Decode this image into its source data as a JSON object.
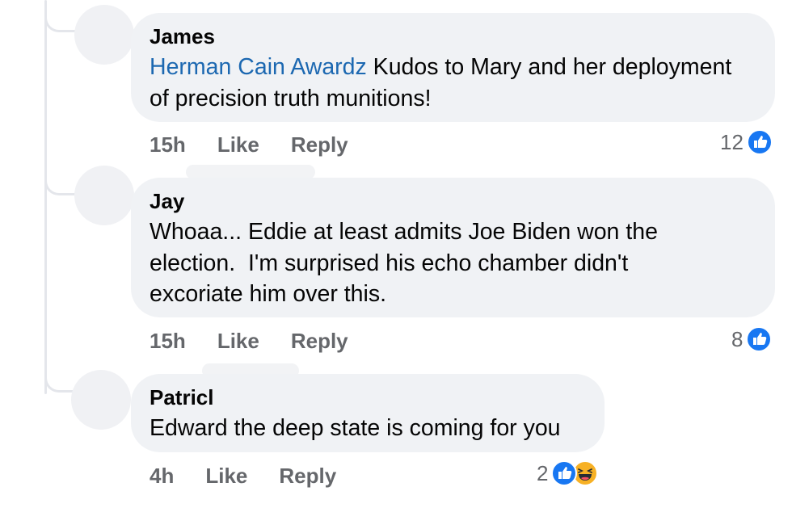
{
  "comments": [
    {
      "author": "James",
      "mention": "Herman Cain Awardz",
      "text": " Kudos to Mary and her deployment of precision truth munitions!",
      "time": "15h",
      "like_label": "Like",
      "reply_label": "Reply",
      "reaction_count": "12",
      "reactions": [
        "like-icon"
      ]
    },
    {
      "author": "Jay",
      "text": "Whoaa... Eddie at least admits Joe Biden won the election.  I'm surprised his echo chamber didn't excoriate him over this.",
      "time": "15h",
      "like_label": "Like",
      "reply_label": "Reply",
      "reaction_count": "8",
      "reactions": [
        "like-icon"
      ]
    },
    {
      "author": "Patricl",
      "text": "Edward the deep state is coming for you",
      "time": "4h",
      "like_label": "Like",
      "reply_label": "Reply",
      "reaction_count": "2",
      "reactions": [
        "like-icon",
        "haha-icon"
      ]
    }
  ],
  "colors": {
    "bubble": "#f0f2f5",
    "mention": "#1c68b1",
    "meta": "#65676b",
    "like_blue": "#1877f2",
    "haha_yellow": "#f7b125"
  }
}
